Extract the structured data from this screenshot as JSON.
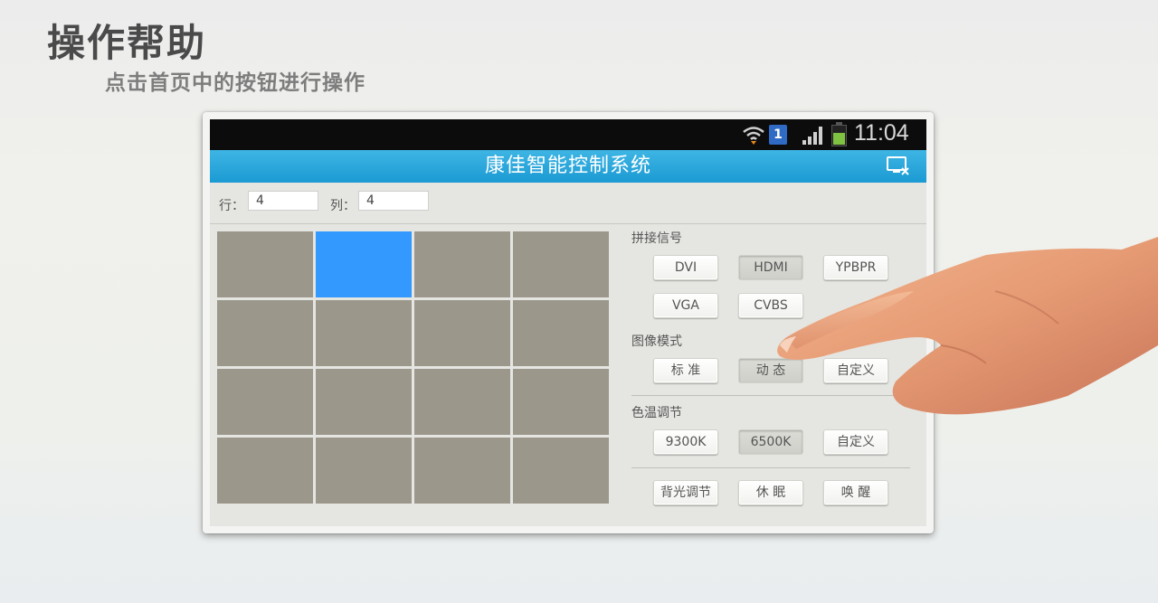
{
  "help": {
    "title": "操作帮助",
    "subtitle": "点击首页中的按钮进行操作"
  },
  "statusbar": {
    "sim_slot": "1",
    "time": "11:04",
    "icons": [
      "wifi-icon",
      "sim-icon",
      "signal-icon",
      "battery-icon"
    ]
  },
  "app": {
    "title": "康佳智能控制系统",
    "exit_icon": "exit-screen-icon",
    "accent_color": "#1b9ad3"
  },
  "layout_inputs": {
    "row_label": "行：",
    "row_value": "4",
    "col_label": "列：",
    "col_value": "4"
  },
  "wall_grid": {
    "rows": 4,
    "cols": 4,
    "selected_cell": [
      0,
      1
    ],
    "cell_color": "#9b978b",
    "selected_color": "#3399ff"
  },
  "signal_section": {
    "label": "拼接信号",
    "buttons": [
      "DVI",
      "HDMI",
      "YPBPR",
      "VGA",
      "CVBS"
    ],
    "pressed": "HDMI"
  },
  "image_mode_section": {
    "label": "图像模式",
    "buttons": [
      "标 准",
      "动 态",
      "自定义"
    ],
    "pressed": "动 态"
  },
  "color_temp_section": {
    "label": "色温调节",
    "buttons": [
      "9300K",
      "6500K",
      "自定义"
    ],
    "pressed": "6500K"
  },
  "bottom_buttons": [
    "背光调节",
    "休 眠",
    "唤 醒"
  ]
}
